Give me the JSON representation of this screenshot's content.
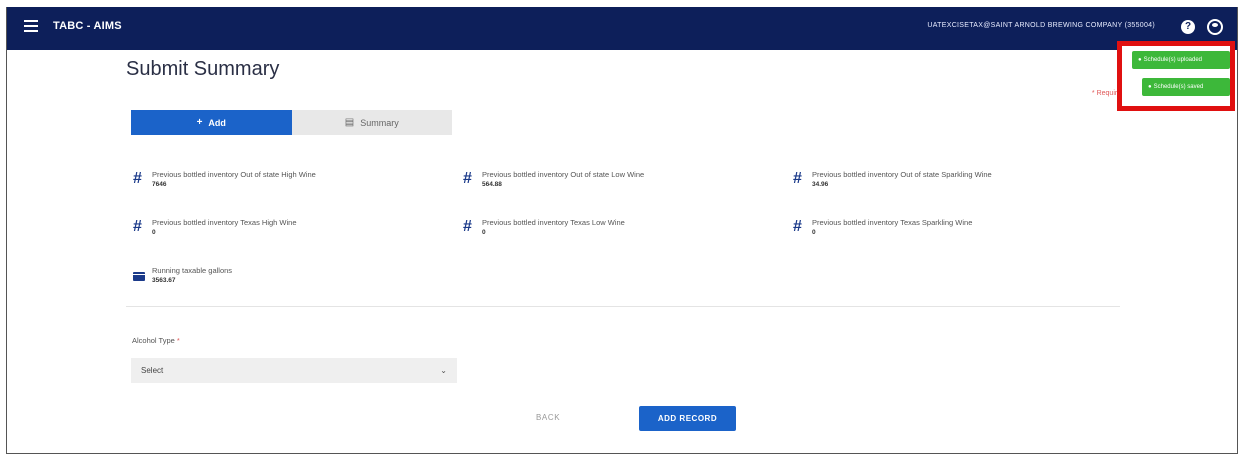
{
  "header": {
    "app_title": "TABC - AIMS",
    "user": "UATEXCISETAX@SAINT ARNOLD BREWING COMPANY (355004)",
    "help_glyph": "?",
    "bg_color": "#0d1f5a"
  },
  "page": {
    "title": "Submit Summary",
    "required_note": "* Required"
  },
  "toasts": {
    "first": "Schedule(s) uploaded",
    "second": "Schedule(s) saved",
    "color": "#3db83a",
    "highlight_color": "#e01010"
  },
  "tabs": {
    "add": {
      "label": "Add",
      "glyph": "+"
    },
    "summary": {
      "label": "Summary",
      "glyph": "▤"
    }
  },
  "metrics": [
    {
      "label": "Previous bottled inventory Out of state High Wine",
      "value": "7646",
      "icon": "hash-icon"
    },
    {
      "label": "Previous bottled inventory Out of state Low Wine",
      "value": "564.88",
      "icon": "hash-icon"
    },
    {
      "label": "Previous bottled inventory Out of state Sparkling Wine",
      "value": "34.96",
      "icon": "hash-icon"
    },
    {
      "label": "Previous bottled inventory Texas High Wine",
      "value": "0",
      "icon": "hash-icon"
    },
    {
      "label": "Previous bottled inventory Texas Low Wine",
      "value": "0",
      "icon": "hash-icon"
    },
    {
      "label": "Previous bottled inventory Texas Sparkling Wine",
      "value": "0",
      "icon": "hash-icon"
    },
    {
      "label": "Running taxable gallons",
      "value": "3563.67",
      "icon": "wallet-icon"
    }
  ],
  "form": {
    "alcohol_type_label": "Alcohol Type",
    "required_marker": "*",
    "alcohol_type_value": "Select",
    "chevron": "⌄"
  },
  "actions": {
    "back": "BACK",
    "add_record": "ADD RECORD"
  }
}
